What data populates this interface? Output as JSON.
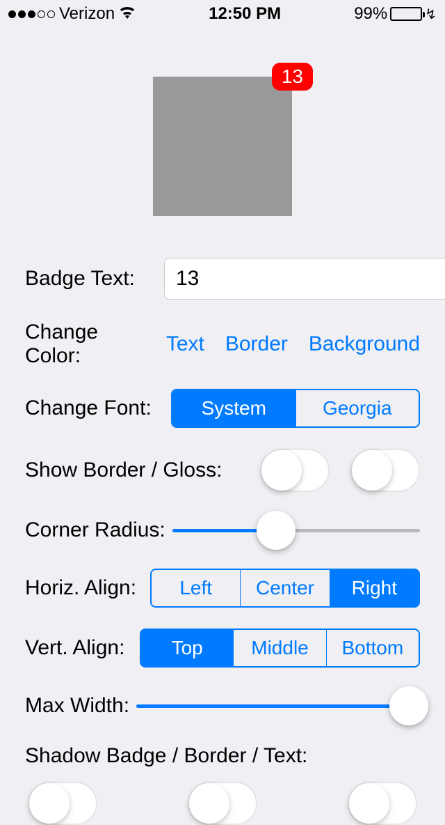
{
  "status": {
    "carrier": "Verizon",
    "time": "12:50 PM",
    "battery": "99%"
  },
  "badge": {
    "text": "13"
  },
  "labels": {
    "badge_text": "Badge Text:",
    "change_color": "Change Color:",
    "change_font": "Change Font:",
    "show_border": "Show Border / Gloss:",
    "corner_radius": "Corner Radius:",
    "horiz_align": "Horiz. Align:",
    "vert_align": "Vert. Align:",
    "max_width": "Max Width:",
    "shadow": "Shadow Badge / Border / Text:"
  },
  "input": {
    "badge_text_value": "13"
  },
  "color_links": {
    "text": "Text",
    "border": "Border",
    "background": "Background"
  },
  "font_seg": {
    "system": "System",
    "georgia": "Georgia"
  },
  "horiz_seg": {
    "left": "Left",
    "center": "Center",
    "right": "Right"
  },
  "vert_seg": {
    "top": "Top",
    "middle": "Middle",
    "bottom": "Bottom"
  }
}
